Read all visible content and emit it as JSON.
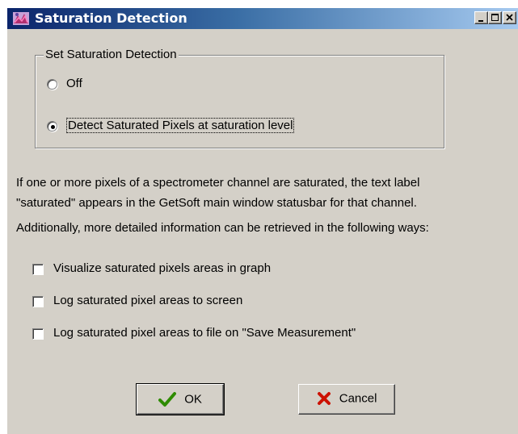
{
  "window": {
    "title": "Saturation Detection",
    "icon": "app-icon",
    "controls": [
      "minimize-icon",
      "maximize-icon",
      "close-icon"
    ]
  },
  "group": {
    "label": "Set Saturation Detection",
    "options": [
      {
        "label": "Off",
        "selected": false
      },
      {
        "label": "Detect Saturated Pixels at saturation level",
        "selected": true
      }
    ]
  },
  "info": {
    "line1": "If one or more pixels of a spectrometer channel are saturated,  the text label",
    "line2": "\"saturated\" appears in the GetSoft main window statusbar for that channel.",
    "line3": "Additionally, more detailed information can be retrieved in the following ways:"
  },
  "checkboxes": [
    {
      "label": "Visualize saturated pixels areas in graph",
      "checked": false
    },
    {
      "label": "Log saturated pixel areas to screen",
      "checked": false
    },
    {
      "label": "Log saturated pixel areas to file on \"Save Measurement\"",
      "checked": false
    }
  ],
  "buttons": {
    "ok": {
      "label": "OK",
      "icon": "checkmark-icon",
      "icon_color": "#2e8b00"
    },
    "cancel": {
      "label": "Cancel",
      "icon": "x-icon",
      "icon_color": "#cc1100"
    }
  },
  "colors": {
    "title_bar_start": "#0a246a",
    "title_bar_end": "#a6caf0",
    "dialog_bg": "#d4d0c8"
  }
}
